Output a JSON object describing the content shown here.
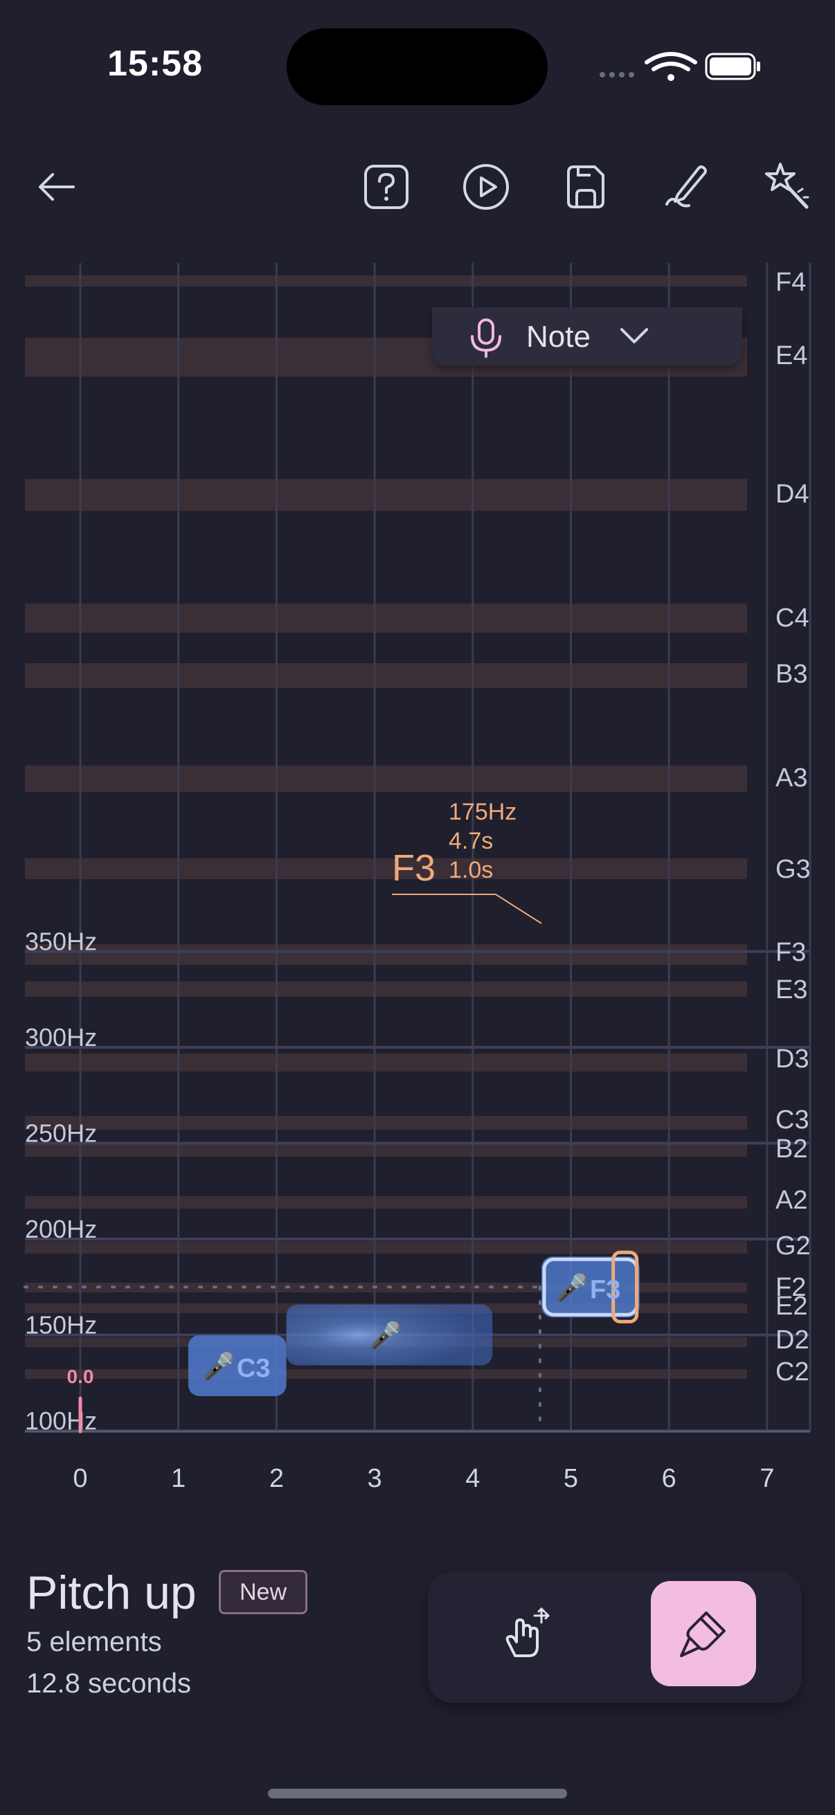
{
  "status_bar": {
    "time": "15:58"
  },
  "toolbar": {
    "back_icon": "arrow-left-icon",
    "icons": [
      "help-icon",
      "play-icon",
      "save-icon",
      "edit-pen-icon",
      "magic-wand-icon"
    ]
  },
  "note_selector": {
    "label": "Note",
    "icon": "microphone-icon"
  },
  "chart_data": {
    "type": "scatter",
    "x_ticks": [
      "0",
      "1",
      "2",
      "3",
      "4",
      "5",
      "6",
      "7"
    ],
    "hz_labels": [
      "350Hz",
      "300Hz",
      "250Hz",
      "200Hz",
      "150Hz",
      "100Hz"
    ],
    "note_labels": [
      "F4",
      "E4",
      "D4",
      "C4",
      "B3",
      "A3",
      "G3",
      "F3",
      "E3",
      "D3",
      "C3",
      "B2",
      "A2",
      "G2",
      "F2",
      "E2",
      "D2",
      "C2"
    ],
    "playhead_label": "0.0",
    "notes": [
      {
        "label": "C3",
        "start": 1.1,
        "end": 2.1,
        "hz": 134
      },
      {
        "label": "",
        "start": 2.1,
        "end": 4.2,
        "hz": 150
      },
      {
        "label": "F3",
        "start": 4.7,
        "end": 5.7,
        "hz": 175
      }
    ],
    "selected_note": {
      "name": "F3",
      "hz": "175Hz",
      "start": "4.7s",
      "duration": "1.0s"
    }
  },
  "project": {
    "title": "Pitch up",
    "badge": "New",
    "elements": "5 elements",
    "duration": "12.8 seconds"
  },
  "modes": {
    "select_icon": "hand-move-icon",
    "brush_icon": "brush-icon"
  },
  "colors": {
    "background": "#1f1f2e",
    "accent_pink": "#f3bde3",
    "note_blue": "#4d76c8",
    "highlight_orange": "#f0a978",
    "band": "#3a2f36"
  }
}
